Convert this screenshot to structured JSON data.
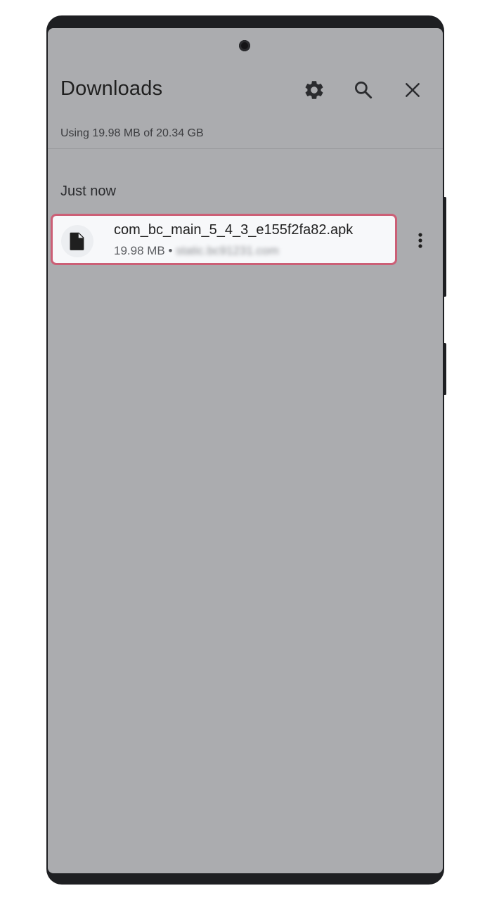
{
  "header": {
    "title": "Downloads",
    "icons": {
      "settings": "gear-icon",
      "search": "search-icon",
      "close": "close-icon"
    }
  },
  "storage": {
    "usage_text": "Using 19.98 MB of 20.34 GB"
  },
  "sections": [
    {
      "label": "Just now",
      "items": [
        {
          "file_name": "com_bc_main_5_4_3_e155f2fa82.apk",
          "size": "19.98 MB",
          "separator": " • ",
          "source": "static.bc91231.com",
          "icon": "file-icon"
        }
      ]
    }
  ],
  "colors": {
    "screen_background": "#abacaf",
    "highlight_border": "#cc5f76",
    "item_background": "#f7f8fa"
  }
}
